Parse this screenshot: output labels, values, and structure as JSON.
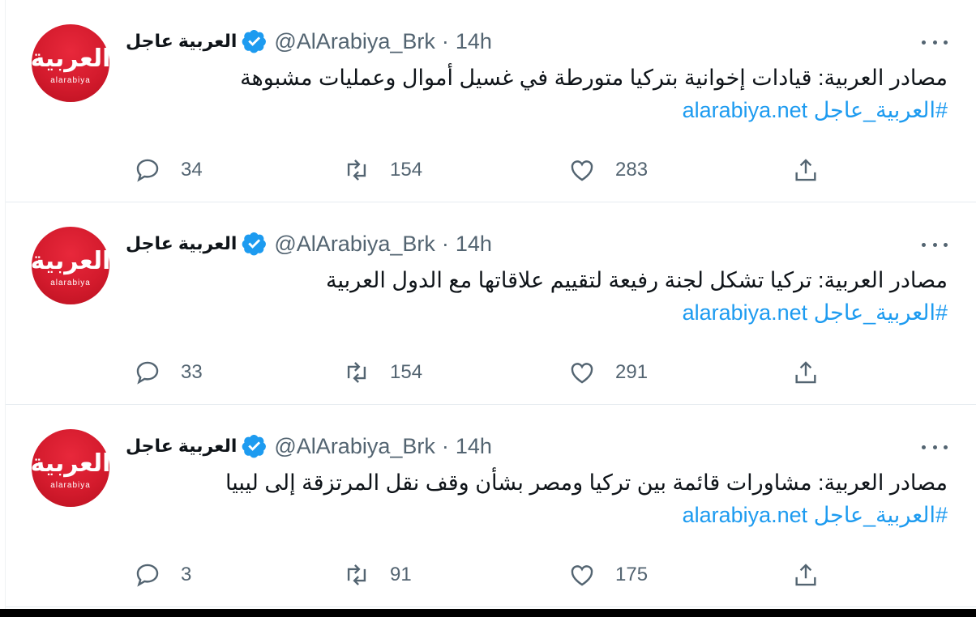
{
  "account": {
    "name": "العربية عاجل",
    "handle": "@AlArabiya_Brk",
    "avatar_ar": "العربية",
    "avatar_en": "alarabiya",
    "verified_color": "#1d9bf0"
  },
  "separator": "·",
  "tweets": [
    {
      "time": "14h",
      "line1": "مصادر العربية: قيادات إخوانية بتركيا متورطة في غسيل أموال وعمليات مشبوهة",
      "line2": "#العربية_عاجل alarabiya.net",
      "replies": "34",
      "retweets": "154",
      "likes": "283"
    },
    {
      "time": "14h",
      "line1": "مصادر العربية: تركيا تشكل لجنة رفيعة لتقييم علاقاتها مع الدول العربية",
      "line2": "#العربية_عاجل alarabiya.net",
      "replies": "33",
      "retweets": "154",
      "likes": "291"
    },
    {
      "time": "14h",
      "line1": "مصادر العربية: مشاورات قائمة بين تركيا ومصر بشأن وقف نقل المرتزقة إلى ليبيا",
      "line2": "#العربية_عاجل alarabiya.net",
      "replies": "3",
      "retweets": "91",
      "likes": "175"
    }
  ],
  "colors": {
    "link": "#1d9bf0",
    "secondary_text": "#536471",
    "avatar_red": "#d41b2d"
  },
  "icons": [
    "reply-icon",
    "retweet-icon",
    "like-icon",
    "share-icon",
    "more-icon",
    "verified-icon"
  ]
}
